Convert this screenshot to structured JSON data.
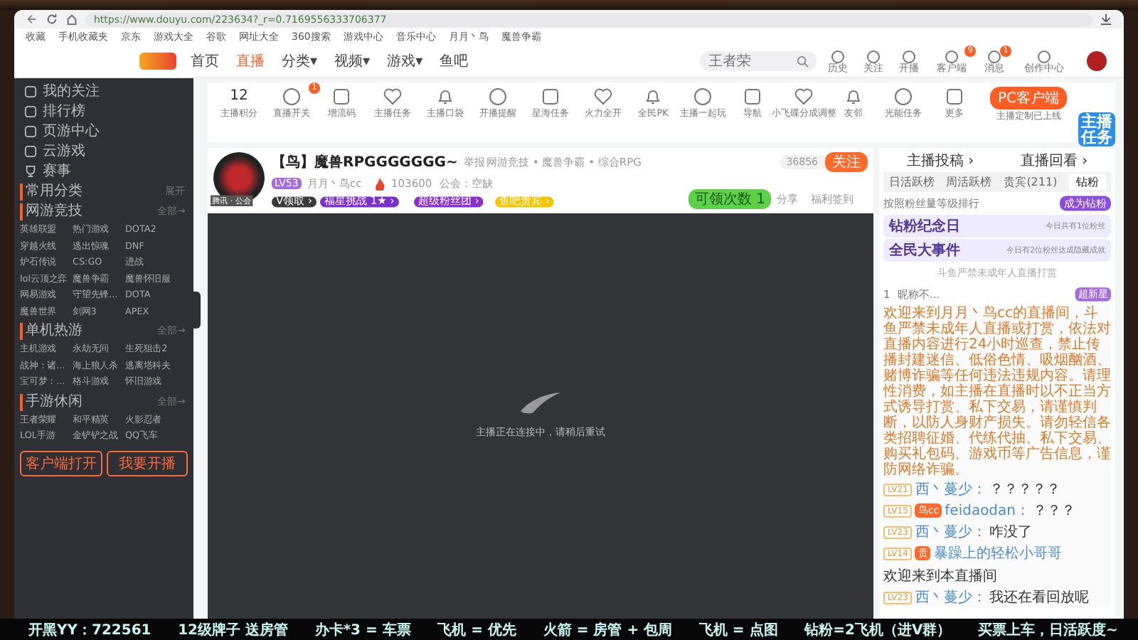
{
  "browser": {
    "url": "https://www.douyu.com/223634?_r=0.7169556333706377",
    "bookmarks": [
      "收藏",
      "手机收藏夹",
      "京东",
      "游戏大全",
      "谷歌",
      "网址大全",
      "360搜索",
      "游戏中心",
      "音乐中心",
      "月月丶鸟",
      "魔兽争霸"
    ]
  },
  "header": {
    "nav": [
      {
        "label": "首页",
        "selected": false
      },
      {
        "label": "直播",
        "selected": true
      },
      {
        "label": "分类▾",
        "selected": false
      },
      {
        "label": "视频▾",
        "selected": false
      },
      {
        "label": "游戏▾",
        "selected": false
      },
      {
        "label": "鱼吧",
        "selected": false
      }
    ],
    "search": {
      "placeholder": "王者荣"
    },
    "tools": [
      {
        "label": "历史"
      },
      {
        "label": "关注"
      },
      {
        "label": "开播"
      },
      {
        "label": "客户端",
        "badge": "9"
      },
      {
        "label": "消息",
        "badge": "1"
      },
      {
        "label": "创作中心"
      }
    ]
  },
  "sidebar": {
    "items": [
      "我的关注",
      "排行榜",
      "页游中心",
      "云游戏"
    ],
    "esports": "赛事",
    "common": "常用分类",
    "common_action": "展开",
    "sections": [
      {
        "title": "网游竞技",
        "more": "全部→",
        "games": [
          "英雄联盟",
          "热门游戏",
          "DOTA2",
          "穿越火线",
          "逃出惊魂",
          "DNF",
          "炉石传说",
          "CS:GO",
          "进战",
          "lol云顶之弈",
          "魔兽争霸",
          "魔兽怀旧服",
          "网易游戏",
          "守望先锋...",
          "DOTA",
          "魔兽世界",
          "剑网3",
          "APEX"
        ]
      },
      {
        "title": "单机热游",
        "more": "全部→",
        "games": [
          "主机游戏",
          "永劫无间",
          "生死狙击2",
          "战神：诸...",
          "海上狼人杀",
          "逃离塔科夫",
          "宝可梦：...",
          "格斗游戏",
          "怀旧游戏"
        ]
      },
      {
        "title": "手游休闲",
        "more": "全部→",
        "games": [
          "王者荣耀",
          "和平精英",
          "火影忍者",
          "LOL手游",
          "金铲铲之战",
          "QQ飞车"
        ]
      }
    ],
    "buttons": [
      "客户端打开",
      "我要开播"
    ]
  },
  "tasks": {
    "score": "12",
    "score_label": "主播积分",
    "items": [
      {
        "label": "直播开关",
        "badge": "1"
      },
      {
        "label": "增流码"
      },
      {
        "label": "主播任务"
      },
      {
        "label": "主播口袋"
      },
      {
        "label": "开播提醒"
      },
      {
        "label": "星海任务"
      },
      {
        "label": "火力全开"
      },
      {
        "label": "全民PK"
      },
      {
        "label": "主播一起玩"
      },
      {
        "label": "导航"
      },
      {
        "label": "小飞碟分成调整"
      },
      {
        "label": "友邻"
      },
      {
        "label": "光能任务"
      },
      {
        "label": "更多"
      }
    ],
    "pc_button": "PC客户端",
    "pc_note": "主播定制已上线"
  },
  "room": {
    "title": "【鸟】魔兽RPGGGGGGG~",
    "report": "举报",
    "category": "网游竞技 • 魔兽争霸 • 综合RPG",
    "level": "LV53",
    "streamer": "月月丶鸟cc",
    "heat": "103600",
    "guild": "公会：空缺",
    "avatar_caption": "腾讯 · 公会",
    "tags": [
      {
        "label": "V领取 ›",
        "color": "#3a3a3a"
      },
      {
        "label": "福星挑战 1★ ›",
        "color": "#7b2fd0"
      },
      {
        "label": "超级粉丝团 ›",
        "color": "#8a2fd0"
      },
      {
        "label": "鱼吧贵宾 ›",
        "color": "#f5c400"
      }
    ],
    "followers": "36856",
    "follow": "关注",
    "claim": "可领次数",
    "claim_count": "1",
    "share": "分享",
    "welfare": "福利签到",
    "video_message": "主播正在连接中，请稍后重试"
  },
  "chat": {
    "links": [
      "主播投稿 ›",
      "直播回看 ›"
    ],
    "tabs": [
      {
        "label": "日活跃榜",
        "selected": false
      },
      {
        "label": "周活跃榜",
        "selected": false
      },
      {
        "label": "贵宾(211)",
        "selected": false
      },
      {
        "label": "钻粉",
        "selected": true
      }
    ],
    "rank_note": "按照粉丝量等级排行",
    "rank_button": "成为钻粉",
    "cards": [
      {
        "title": "钻粉纪念日",
        "note": "今日共有1位粉丝"
      },
      {
        "title": "全民大事件",
        "note": "今日有2位粉丝达成隐藏成就"
      }
    ],
    "notice": "斗鱼严禁未成年人直播打赏",
    "rank_row": {
      "rank": "1",
      "name": "昵称不...",
      "badge": "超新星"
    },
    "system": "欢迎来到月月丶鸟cc的直播间，斗鱼严禁未成年人直播或打赏，依法对直播内容进行24小时巡查，禁止传播封建迷信、低俗色情、吸烟酗酒、赌博诈骗等任何违法违规内容。请理性消费，如主播在直播时以不正当方式诱导打赏、私下交易，请谨慎判断，以防人身财产损失。请勿轻信各类招聘征婚、代练代抽、私下交易、购买礼包码、游戏币等广告信息，谨防网络诈骗。",
    "messages": [
      {
        "level": "LV21",
        "name": "西丶蔓少：",
        "text": "？？？？？"
      },
      {
        "level": "LV15",
        "badge": "鸟cc",
        "name": "feidaodan：",
        "text": "？？？"
      },
      {
        "level": "LV23",
        "name": "西丶蔓少：",
        "text": "咋没了"
      },
      {
        "level": "LV14",
        "badge": "贵",
        "name": "暴躁上的轻松小哥哥",
        "text": "欢迎来到本直播间"
      },
      {
        "level": "LV23",
        "name": "西丶蔓少：",
        "text": "我还在看回放呢"
      }
    ],
    "sticker": "主播任务"
  },
  "ticker": [
    "开黑YY：722561",
    "12级牌子 送房管",
    "办卡*3 = 车票",
    "飞机 = 优先",
    "火箭 = 房管 + 包周",
    "飞机 = 点图",
    "钻粉=2飞机（进V群）",
    "买票上车，日活跃度~"
  ]
}
